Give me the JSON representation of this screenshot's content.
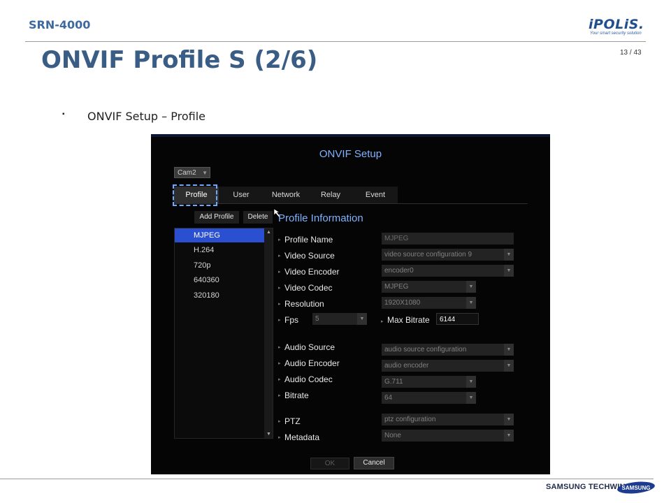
{
  "header": {
    "product_code": "SRN-4000",
    "logo_brand": "iPOLiS.",
    "logo_tagline": "Your smart security solution",
    "page_number": "13 / 43"
  },
  "slide": {
    "title": "ONVIF Profile S (2/6)",
    "bullet_mark": "▪",
    "bullet_text": "ONVIF Setup – Profile"
  },
  "dialog": {
    "title": "ONVIF Setup",
    "camera_select": "Cam2",
    "tabs": [
      {
        "label": "Profile",
        "active": true
      },
      {
        "label": "User",
        "active": false
      },
      {
        "label": "Network",
        "active": false
      },
      {
        "label": "Relay",
        "active": false
      },
      {
        "label": "Event",
        "active": false
      }
    ],
    "add_profile_label": "Add Profile",
    "delete_label": "Delete",
    "profiles": [
      {
        "name": "MJPEG",
        "selected": true
      },
      {
        "name": "H.264",
        "selected": false
      },
      {
        "name": "720p",
        "selected": false
      },
      {
        "name": "640360",
        "selected": false
      },
      {
        "name": "320180",
        "selected": false
      }
    ],
    "info_title": "Profile Information",
    "fields": {
      "profile_name": {
        "label": "Profile Name",
        "value": "MJPEG"
      },
      "video_source": {
        "label": "Video Source",
        "value": "video source configuration 9"
      },
      "video_encoder": {
        "label": "Video Encoder",
        "value": "encoder0"
      },
      "video_codec": {
        "label": "Video Codec",
        "value": "MJPEG"
      },
      "resolution": {
        "label": "Resolution",
        "value": "1920X1080"
      },
      "fps": {
        "label": "Fps",
        "value": "5"
      },
      "max_bitrate": {
        "label": "Max Bitrate",
        "value": "6144"
      },
      "audio_source": {
        "label": "Audio Source",
        "value": "audio source configuration"
      },
      "audio_encoder": {
        "label": "Audio Encoder",
        "value": "audio encoder"
      },
      "audio_codec": {
        "label": "Audio Codec",
        "value": "G.711"
      },
      "bitrate": {
        "label": "Bitrate",
        "value": "64"
      },
      "ptz": {
        "label": "PTZ",
        "value": "ptz configuration"
      },
      "metadata": {
        "label": "Metadata",
        "value": "None"
      }
    },
    "ok_label": "OK",
    "cancel_label": "Cancel"
  },
  "footer": {
    "brand": "SAMSUNG TECHWIN",
    "logo_text": "SAMSUNG"
  },
  "colors": {
    "title_blue": "#3a5d86",
    "dialog_accent": "#7fb2ff",
    "selection_blue": "#2a4fd0"
  }
}
